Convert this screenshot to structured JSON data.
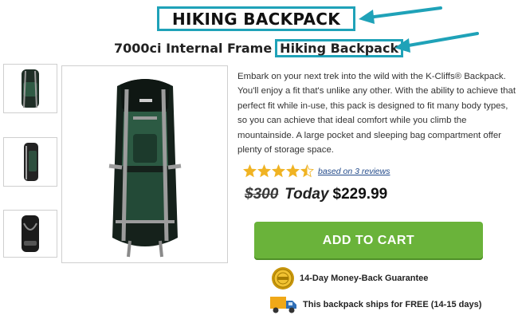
{
  "product": {
    "heading": "HIKING BACKPACK",
    "subtitle_prefix": "7000ci Internal Frame",
    "subtitle_highlight": "Hiking Backpack",
    "description": "Embark on your next trek into the wild with the K-Cliffs® Backpack. You'll enjoy a fit that's unlike any other. With the ability to achieve that perfect fit while in-use, this pack is designed to fit many body types, so you can achieve that ideal comfort while you climb the mountainside. A large pocket and sleeping bag compartment offer plenty of storage space."
  },
  "rating": {
    "stars": 4.5,
    "max": 5,
    "reviews_link": "based on 3 reviews",
    "star_color": "#f0b323"
  },
  "pricing": {
    "old_price": "$300",
    "today_label": "Today",
    "new_price": "$229.99"
  },
  "cart": {
    "button_label": "ADD TO CART",
    "color": "#6ab33a"
  },
  "perks": [
    {
      "icon": "gold-seal-icon",
      "text": "14-Day Money-Back Guarantee"
    },
    {
      "icon": "delivery-truck-icon",
      "text": "This backpack ships for FREE (14-15 days)"
    }
  ],
  "highlight_color": "#1fa2b8"
}
